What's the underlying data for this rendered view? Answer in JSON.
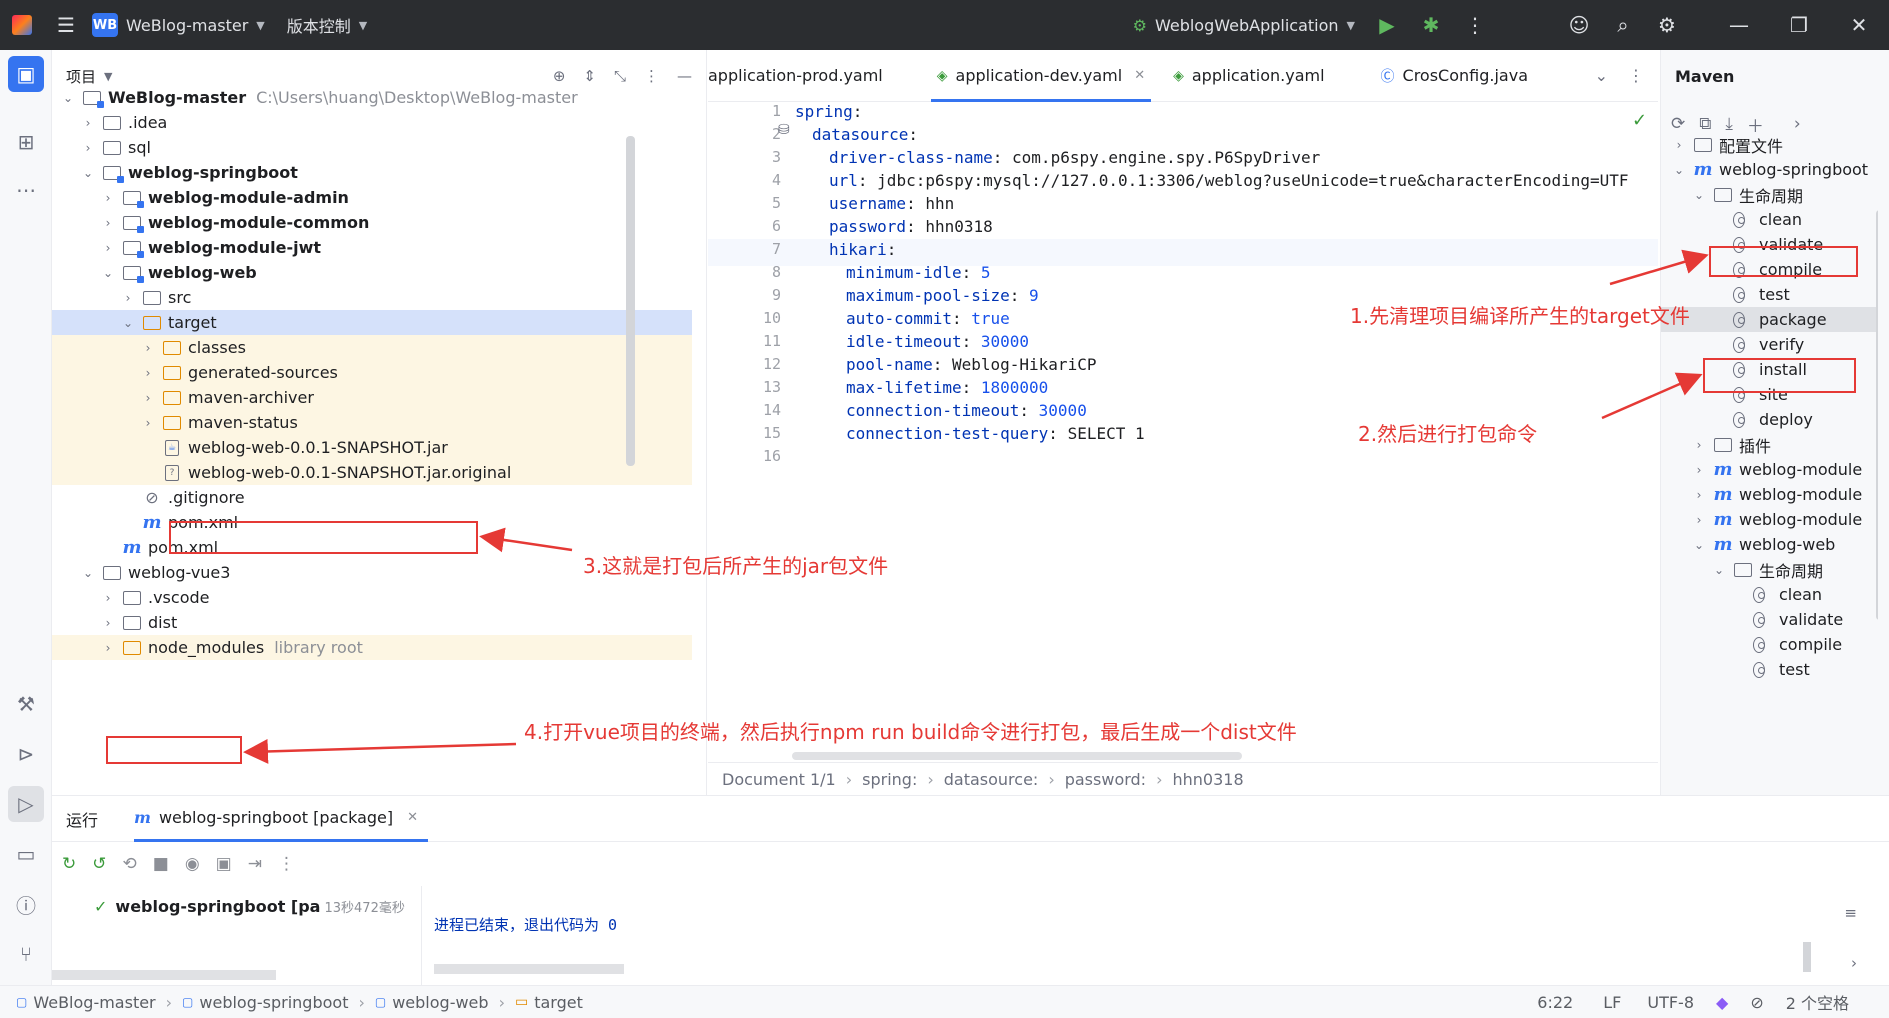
{
  "titlebar": {
    "project_badge": "WB",
    "project_name": "WeBlog-master",
    "vcs_menu": "版本控制",
    "run_config": "WeblogWebApplication"
  },
  "project_panel": {
    "title": "项目",
    "tree": [
      {
        "label": "WeBlog-master",
        "path": "C:\\Users\\huang\\Desktop\\WeBlog-master",
        "depth": 0,
        "icon": "module",
        "open": true,
        "bold": true
      },
      {
        "label": ".idea",
        "depth": 1,
        "icon": "folder"
      },
      {
        "label": "sql",
        "depth": 1,
        "icon": "folder"
      },
      {
        "label": "weblog-springboot",
        "depth": 1,
        "icon": "module",
        "open": true,
        "bold": true
      },
      {
        "label": "weblog-module-admin",
        "depth": 2,
        "icon": "module",
        "bold": true
      },
      {
        "label": "weblog-module-common",
        "depth": 2,
        "icon": "module",
        "bold": true
      },
      {
        "label": "weblog-module-jwt",
        "depth": 2,
        "icon": "module",
        "bold": true
      },
      {
        "label": "weblog-web",
        "depth": 2,
        "icon": "module",
        "open": true,
        "bold": true
      },
      {
        "label": "src",
        "depth": 3,
        "icon": "folder"
      },
      {
        "label": "target",
        "depth": 3,
        "icon": "orange",
        "open": true,
        "selected": true
      },
      {
        "label": "classes",
        "depth": 4,
        "icon": "orange",
        "excluded": true
      },
      {
        "label": "generated-sources",
        "depth": 4,
        "icon": "orange",
        "excluded": true
      },
      {
        "label": "maven-archiver",
        "depth": 4,
        "icon": "orange",
        "excluded": true
      },
      {
        "label": "maven-status",
        "depth": 4,
        "icon": "orange",
        "excluded": true
      },
      {
        "label": "weblog-web-0.0.1-SNAPSHOT.jar",
        "depth": 4,
        "icon": "jar",
        "leaf": true,
        "excluded": true
      },
      {
        "label": "weblog-web-0.0.1-SNAPSHOT.jar.original",
        "depth": 4,
        "icon": "unknown",
        "leaf": true,
        "excluded": true
      },
      {
        "label": ".gitignore",
        "depth": 3,
        "icon": "ignore",
        "leaf": true
      },
      {
        "label": "pom.xml",
        "depth": 3,
        "icon": "maven",
        "leaf": true
      },
      {
        "label": "pom.xml",
        "depth": 2,
        "icon": "maven",
        "leaf": true
      },
      {
        "label": "weblog-vue3",
        "depth": 1,
        "icon": "folder",
        "open": true
      },
      {
        "label": ".vscode",
        "depth": 2,
        "icon": "folder"
      },
      {
        "label": "dist",
        "depth": 2,
        "icon": "folder"
      },
      {
        "label": "node_modules",
        "path": "library root",
        "depth": 2,
        "icon": "orange",
        "excluded": true
      }
    ]
  },
  "editor": {
    "tabs": [
      {
        "label": "application-prod.yaml",
        "active": false
      },
      {
        "label": "application-dev.yaml",
        "active": true
      },
      {
        "label": "application.yaml",
        "active": false
      },
      {
        "label": "CrosConfig.java",
        "active": false
      }
    ],
    "lines": [
      {
        "n": "1",
        "indent": 0,
        "key": "spring",
        "val": ""
      },
      {
        "n": "2",
        "indent": 1,
        "key": "datasource",
        "val": ""
      },
      {
        "n": "3",
        "indent": 2,
        "key": "driver-class-name",
        "val": "com.p6spy.engine.spy.P6SpyDriver",
        "type": "plain"
      },
      {
        "n": "4",
        "indent": 2,
        "key": "url",
        "val": "jdbc:p6spy:mysql://127.0.0.1:3306/weblog?useUnicode=true&characterEncoding=UTF",
        "type": "plain"
      },
      {
        "n": "5",
        "indent": 2,
        "key": "username",
        "val": "hhn",
        "type": "plain"
      },
      {
        "n": "6",
        "indent": 2,
        "key": "password",
        "val": "hhn0318",
        "type": "plain"
      },
      {
        "n": "7",
        "indent": 2,
        "key": "hikari",
        "val": ""
      },
      {
        "n": "8",
        "indent": 3,
        "key": "minimum-idle",
        "val": "5",
        "type": "num"
      },
      {
        "n": "9",
        "indent": 3,
        "key": "maximum-pool-size",
        "val": "9",
        "type": "num"
      },
      {
        "n": "10",
        "indent": 3,
        "key": "auto-commit",
        "val": "true",
        "type": "num"
      },
      {
        "n": "11",
        "indent": 3,
        "key": "idle-timeout",
        "val": "30000",
        "type": "num"
      },
      {
        "n": "12",
        "indent": 3,
        "key": "pool-name",
        "val": "Weblog-HikariCP",
        "type": "plain"
      },
      {
        "n": "13",
        "indent": 3,
        "key": "max-lifetime",
        "val": "1800000",
        "type": "num"
      },
      {
        "n": "14",
        "indent": 3,
        "key": "connection-timeout",
        "val": "30000",
        "type": "num"
      },
      {
        "n": "15",
        "indent": 3,
        "key": "connection-test-query",
        "val": "SELECT 1",
        "type": "plain"
      },
      {
        "n": "16",
        "indent": 0,
        "key": "",
        "val": ""
      }
    ],
    "breadcrumbs": [
      "Document 1/1",
      "spring:",
      "datasource:",
      "password:",
      "hhn0318"
    ]
  },
  "maven": {
    "title": "Maven",
    "tree": [
      {
        "label": "配置文件",
        "depth": 0,
        "icon": "folder"
      },
      {
        "label": "weblog-springboot",
        "depth": 0,
        "icon": "maven",
        "open": true
      },
      {
        "label": "生命周期",
        "depth": 1,
        "icon": "folder",
        "open": true
      },
      {
        "label": "clean",
        "depth": 2,
        "icon": "gear"
      },
      {
        "label": "validate",
        "depth": 2,
        "icon": "gear"
      },
      {
        "label": "compile",
        "depth": 2,
        "icon": "gear"
      },
      {
        "label": "test",
        "depth": 2,
        "icon": "gear"
      },
      {
        "label": "package",
        "depth": 2,
        "icon": "gear",
        "selected": true
      },
      {
        "label": "verify",
        "depth": 2,
        "icon": "gear"
      },
      {
        "label": "install",
        "depth": 2,
        "icon": "gear"
      },
      {
        "label": "site",
        "depth": 2,
        "icon": "gear"
      },
      {
        "label": "deploy",
        "depth": 2,
        "icon": "gear"
      },
      {
        "label": "插件",
        "depth": 1,
        "icon": "folder"
      },
      {
        "label": "weblog-module",
        "depth": 1,
        "icon": "maven"
      },
      {
        "label": "weblog-module",
        "depth": 1,
        "icon": "maven"
      },
      {
        "label": "weblog-module",
        "depth": 1,
        "icon": "maven"
      },
      {
        "label": "weblog-web",
        "depth": 1,
        "icon": "maven",
        "open": true
      },
      {
        "label": "生命周期",
        "depth": 2,
        "icon": "folder",
        "open": true
      },
      {
        "label": "clean",
        "depth": 3,
        "icon": "gear"
      },
      {
        "label": "validate",
        "depth": 3,
        "icon": "gear"
      },
      {
        "label": "compile",
        "depth": 3,
        "icon": "gear"
      },
      {
        "label": "test",
        "depth": 3,
        "icon": "gear"
      }
    ]
  },
  "run": {
    "tab_label": "运行",
    "run_config_tab": "weblog-springboot [package]",
    "tree_item": "weblog-springboot [pa",
    "duration": "13秒472毫秒",
    "console_output": "进程已结束，退出代码为 0"
  },
  "statusbar": {
    "crumbs": [
      "WeBlog-master",
      "weblog-springboot",
      "weblog-web",
      "target"
    ],
    "position": "6:22",
    "line_sep": "LF",
    "encoding": "UTF-8",
    "indent": "2 个空格"
  },
  "annotations": {
    "a1": "1.先清理项目编译所产生的target文件",
    "a2": "2.然后进行打包命令",
    "a3": "3.这就是打包后所产生的jar包文件",
    "a4": "4.打开vue项目的终端，然后执行npm run build命令进行打包，最后生成一个dist文件"
  },
  "colors": {
    "accent": "#3574f0",
    "annotation_red": "#e53935",
    "titlebar": "#2b2d30"
  }
}
